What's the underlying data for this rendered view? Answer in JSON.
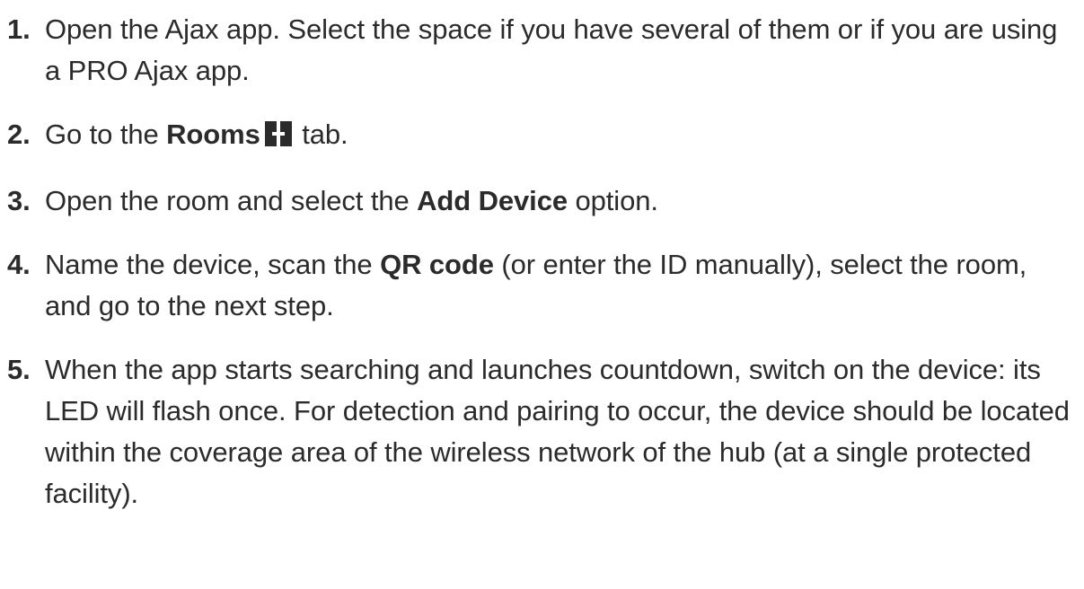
{
  "steps": [
    {
      "number": "1.",
      "text": "Open the Ajax app. Select the space if you have several of them or if you are using a PRO Ajax app."
    },
    {
      "number": "2.",
      "before": "Go to the ",
      "bold": "Rooms",
      "icon": "rooms-icon",
      "after": " tab."
    },
    {
      "number": "3.",
      "before": "Open the room and select the ",
      "bold": "Add Device",
      "after": " option."
    },
    {
      "number": "4.",
      "before": "Name the device, scan the ",
      "bold": "QR code",
      "after": " (or enter the ID manually), select the room, and go to the next step."
    },
    {
      "number": "5.",
      "text": "When the app starts searching and launches countdown, switch on the device: its LED will flash once. For detection and pairing to occur, the device should be located within the coverage area of the wireless network of the hub (at a single protected facility)."
    }
  ],
  "colors": {
    "text": "#2b2b2b",
    "icon": "#2b2b2b",
    "background": "#ffffff"
  }
}
